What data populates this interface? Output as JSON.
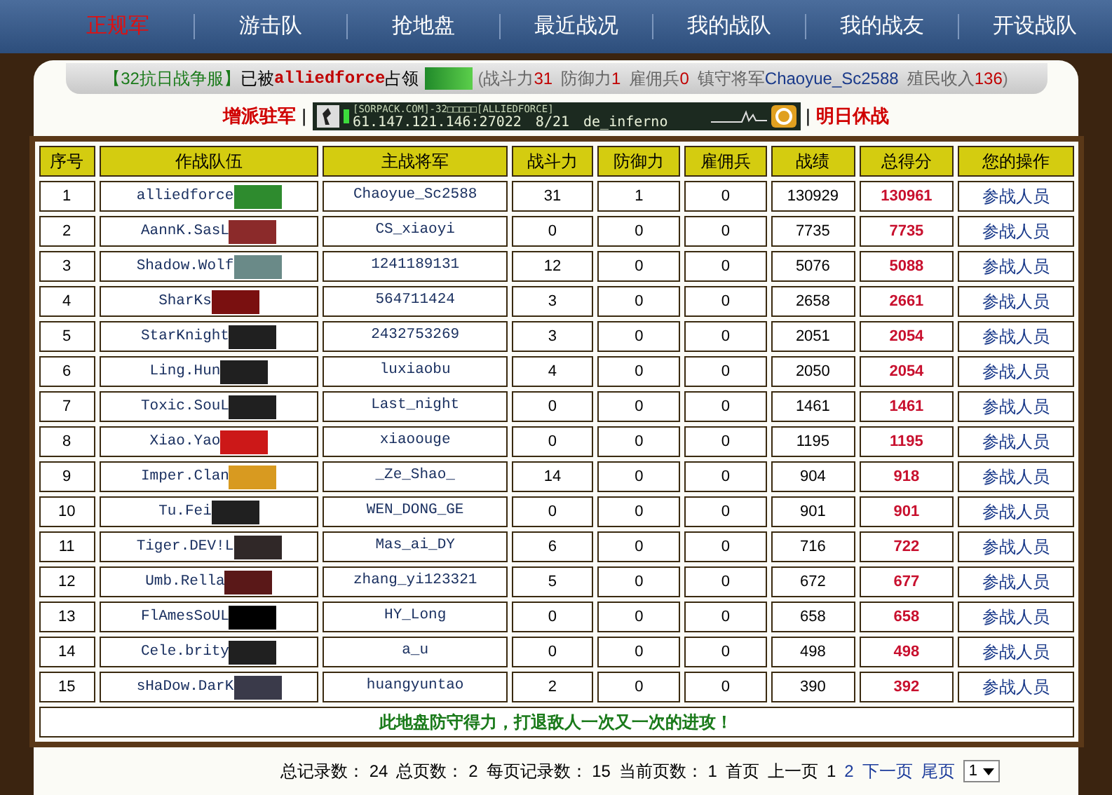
{
  "nav": [
    {
      "label": "正规军",
      "selected": true
    },
    {
      "label": "游击队",
      "selected": false
    },
    {
      "label": "抢地盘",
      "selected": false
    },
    {
      "label": "最近战况",
      "selected": false
    },
    {
      "label": "我的战队",
      "selected": false
    },
    {
      "label": "我的战友",
      "selected": false
    },
    {
      "label": "开设战队",
      "selected": false
    }
  ],
  "occupation": {
    "server": "【32抗日战争服】",
    "prefix": "已被",
    "team": "alliedforce",
    "suffix": "占领",
    "open": "(",
    "close": ")",
    "stats": [
      {
        "label": "战斗力",
        "value": "31"
      },
      {
        "label": "防御力",
        "value": "1"
      },
      {
        "label": "雇佣兵",
        "value": "0"
      },
      {
        "label": "镇守将军",
        "value": "Chaoyue_Sc2588"
      },
      {
        "label": "殖民收入",
        "value": "136"
      }
    ]
  },
  "actions": {
    "left": "增派驻军",
    "separator": "|",
    "right": "明日休战"
  },
  "server_banner": {
    "name": "[SORPACK.COM]-32□□□□□[ALLIEDFORCE]",
    "address": "61.147.121.146:27022",
    "players": "8/21",
    "map": "de_inferno"
  },
  "table": {
    "columns": [
      "序号",
      "作战队伍",
      "主战将军",
      "战斗力",
      "防御力",
      "雇佣兵",
      "战绩",
      "总得分",
      "您的操作"
    ],
    "rows": [
      {
        "no": "1",
        "team": "alliedforce",
        "color": "#2e8b2e",
        "general": "Chaoyue_Sc2588",
        "attack": "31",
        "defense": "1",
        "mercs": "0",
        "record": "130929",
        "total": "130961",
        "action": "参战人员"
      },
      {
        "no": "2",
        "team": "AannK.SasL",
        "color": "#8b2a2a",
        "general": "CS_xiaoyi",
        "attack": "0",
        "defense": "0",
        "mercs": "0",
        "record": "7735",
        "total": "7735",
        "action": "参战人员"
      },
      {
        "no": "3",
        "team": "Shadow.Wolf",
        "color": "#6a8a88",
        "general": "1241189131",
        "attack": "12",
        "defense": "0",
        "mercs": "0",
        "record": "5076",
        "total": "5088",
        "action": "参战人员"
      },
      {
        "no": "4",
        "team": "SharKs",
        "color": "#7a1010",
        "general": "564711424",
        "attack": "3",
        "defense": "0",
        "mercs": "0",
        "record": "2658",
        "total": "2661",
        "action": "参战人员"
      },
      {
        "no": "5",
        "team": "StarKnight",
        "color": "#202020",
        "general": "2432753269",
        "attack": "3",
        "defense": "0",
        "mercs": "0",
        "record": "2051",
        "total": "2054",
        "action": "参战人员"
      },
      {
        "no": "6",
        "team": "Ling.Hun",
        "color": "#202020",
        "general": "luxiaobu",
        "attack": "4",
        "defense": "0",
        "mercs": "0",
        "record": "2050",
        "total": "2054",
        "action": "参战人员"
      },
      {
        "no": "7",
        "team": "Toxic.SouL",
        "color": "#202020",
        "general": "Last_night",
        "attack": "0",
        "defense": "0",
        "mercs": "0",
        "record": "1461",
        "total": "1461",
        "action": "参战人员"
      },
      {
        "no": "8",
        "team": "Xiao.Yao",
        "color": "#cc1818",
        "general": "xiaoouge",
        "attack": "0",
        "defense": "0",
        "mercs": "0",
        "record": "1195",
        "total": "1195",
        "action": "参战人员"
      },
      {
        "no": "9",
        "team": "Imper.Clan",
        "color": "#d89a20",
        "general": "_Ze_Shao_",
        "attack": "14",
        "defense": "0",
        "mercs": "0",
        "record": "904",
        "total": "918",
        "action": "参战人员"
      },
      {
        "no": "10",
        "team": "Tu.Fei",
        "color": "#202020",
        "general": "WEN_DONG_GE",
        "attack": "0",
        "defense": "0",
        "mercs": "0",
        "record": "901",
        "total": "901",
        "action": "参战人员"
      },
      {
        "no": "11",
        "team": "Tiger.DEV!L",
        "color": "#302828",
        "general": "Mas_ai_DY",
        "attack": "6",
        "defense": "0",
        "mercs": "0",
        "record": "716",
        "total": "722",
        "action": "参战人员"
      },
      {
        "no": "12",
        "team": "Umb.Rella",
        "color": "#5a1818",
        "general": "zhang_yi123321",
        "attack": "5",
        "defense": "0",
        "mercs": "0",
        "record": "672",
        "total": "677",
        "action": "参战人员"
      },
      {
        "no": "13",
        "team": "FlAmesSoUL",
        "color": "#000000",
        "general": "HY_Long",
        "attack": "0",
        "defense": "0",
        "mercs": "0",
        "record": "658",
        "total": "658",
        "action": "参战人员"
      },
      {
        "no": "14",
        "team": "Cele.brity",
        "color": "#202020",
        "general": "a_u",
        "attack": "0",
        "defense": "0",
        "mercs": "0",
        "record": "498",
        "total": "498",
        "action": "参战人员"
      },
      {
        "no": "15",
        "team": "sHaDow.DarK",
        "color": "#3a3a4a",
        "general": "huangyuntao",
        "attack": "2",
        "defense": "0",
        "mercs": "0",
        "record": "390",
        "total": "392",
        "action": "参战人员"
      }
    ],
    "footer": "此地盘防守得力，打退敌人一次又一次的进攻！"
  },
  "pagination": {
    "stats": [
      {
        "label": "总记录数：",
        "value": "24"
      },
      {
        "label": "总页数：",
        "value": "2"
      },
      {
        "label": "每页记录数：",
        "value": "15"
      },
      {
        "label": "当前页数：",
        "value": "1"
      }
    ],
    "links": [
      {
        "label": "首页",
        "disabled": true
      },
      {
        "label": "上一页",
        "disabled": true
      },
      {
        "label": "1",
        "disabled": true
      },
      {
        "label": "2",
        "disabled": false
      },
      {
        "label": "下一页",
        "disabled": false
      },
      {
        "label": "尾页",
        "disabled": false
      }
    ],
    "page_select": "1"
  }
}
